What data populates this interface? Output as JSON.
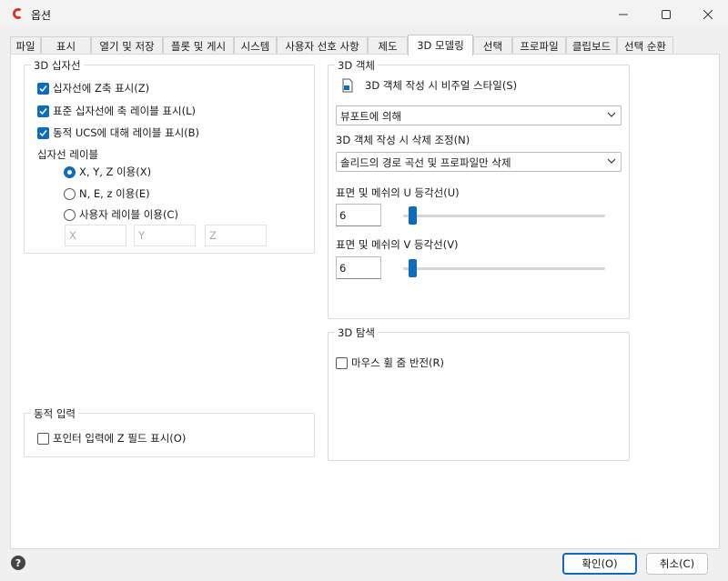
{
  "window": {
    "title": "옵션"
  },
  "tabs": [
    {
      "label": "파일"
    },
    {
      "label": "표시"
    },
    {
      "label": "열기 및 저장"
    },
    {
      "label": "플롯 및 게시"
    },
    {
      "label": "시스템"
    },
    {
      "label": "사용자 선호 사항"
    },
    {
      "label": "제도"
    },
    {
      "label": "3D 모델링"
    },
    {
      "label": "선택"
    },
    {
      "label": "프로파일"
    },
    {
      "label": "클립보드"
    },
    {
      "label": "선택 순환"
    }
  ],
  "crosshair": {
    "title": "3D 십자선",
    "show_z_axis": {
      "label": "십자선에 Z축 표시(Z)",
      "checked": true
    },
    "label_axes": {
      "label": "표준 십자선에 축 레이블 표시(L)",
      "checked": true
    },
    "dynamic_ucs_labels": {
      "label": "동적 UCS에 대해 레이블 표시(B)",
      "checked": true
    },
    "labels_heading": "십자선 레이블",
    "radio_xyz": {
      "label": "X, Y, Z 이용(X)",
      "checked": true
    },
    "radio_nez": {
      "label": "N, E, z 이용(E)",
      "checked": false
    },
    "radio_custom": {
      "label": "사용자 레이블 이용(C)",
      "checked": false
    },
    "custom_x": "X",
    "custom_y": "Y",
    "custom_z": "Z"
  },
  "dynamic_input": {
    "title": "동적 입력",
    "show_z_field": {
      "label": "포인터 입력에 Z 필드 표시(O)",
      "checked": false
    }
  },
  "objects_3d": {
    "title": "3D 객체",
    "visual_style_label": "3D 객체 작성 시 비주얼 스타일(S)",
    "visual_style_value": "뷰포트에 의해",
    "deletion_label": "3D 객체 작성 시 삭제 조정(N)",
    "deletion_value": "솔리드의 경로 곡선 및 프로파일만 삭제",
    "u_isolines_label": "표면 및 메쉬의 U 등각선(U)",
    "u_isolines_value": "6",
    "u_slider_fraction": 0.03,
    "v_isolines_label": "표면 및 메쉬의 V 등각선(V)",
    "v_isolines_value": "6",
    "v_slider_fraction": 0.03
  },
  "navigation_3d": {
    "title": "3D 탐색",
    "reverse_wheel_zoom": {
      "label": "마우스 휠 줌 반전(R)",
      "checked": false
    }
  },
  "footer": {
    "ok_label": "확인(O)",
    "cancel_label": "취소(C)"
  },
  "colors": {
    "accent": "#0f6cbd",
    "logo": "#d9342b"
  }
}
